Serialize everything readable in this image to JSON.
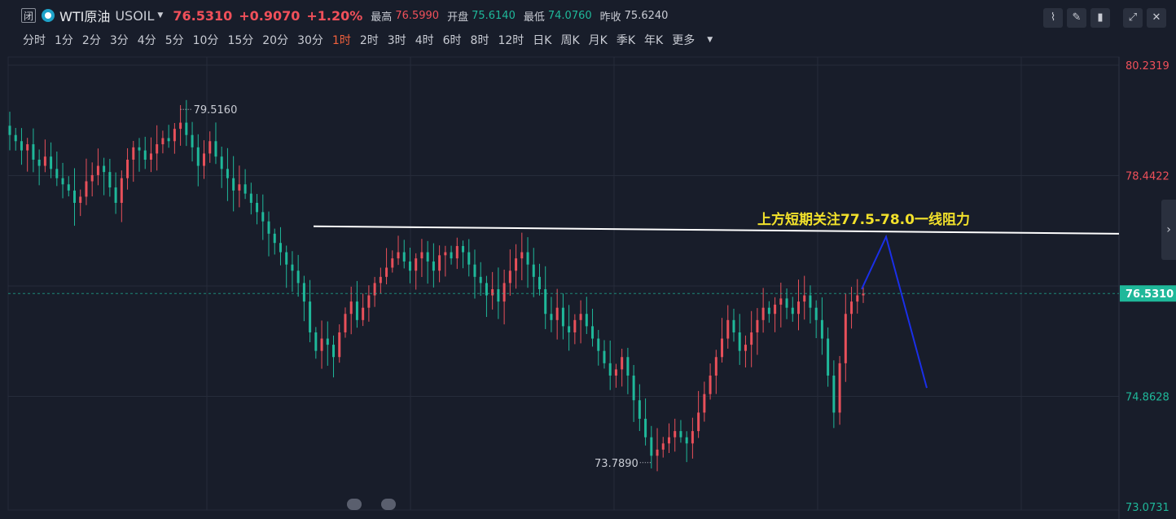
{
  "header": {
    "close_icon": "闭",
    "name": "WTI原油",
    "code": "USOIL",
    "last_price": "76.5310",
    "change": "+0.9070",
    "change_pct": "+1.20%",
    "stats": [
      {
        "label": "最高",
        "value": "76.5990",
        "tone": "red"
      },
      {
        "label": "开盘",
        "value": "75.6140",
        "tone": "green"
      },
      {
        "label": "最低",
        "value": "74.0760",
        "tone": "green"
      },
      {
        "label": "昨收",
        "value": "75.6240",
        "tone": "plain"
      }
    ],
    "timeframes": [
      "分时",
      "1分",
      "2分",
      "3分",
      "4分",
      "5分",
      "10分",
      "15分",
      "20分",
      "30分",
      "1时",
      "2时",
      "3时",
      "4时",
      "6时",
      "8时",
      "12时",
      "日K",
      "周K",
      "月K",
      "季K",
      "年K",
      "更多"
    ],
    "active_timeframe": "1时",
    "tool_icons": [
      "line-chart-icon",
      "pen-icon",
      "candle-icon",
      "expand-icon",
      "close-icon"
    ]
  },
  "chart_data": {
    "type": "candlestick",
    "ylim": [
      73.0731,
      80.2319
    ],
    "ytick_labels": [
      "80.2319",
      "78.4422",
      "74.8628",
      "73.0731"
    ],
    "current_price_label": "76.5310",
    "current_price": 76.531,
    "high_marker": "79.5160",
    "low_marker": "73.7890",
    "annotation": "上方短期关注77.5-78.0一线阻力",
    "resistance_line": {
      "from": 77.62,
      "to": 77.5
    },
    "projection_path": [
      76.6,
      77.45,
      75.0
    ],
    "colors": {
      "up": "#e8505a",
      "down": "#1fb89a",
      "line": "#ffffff",
      "projection": "#1a2fe8",
      "annotation": "#f2e12b"
    },
    "close_path": [
      79.1,
      79.0,
      78.85,
      78.95,
      78.7,
      78.6,
      78.75,
      78.55,
      78.4,
      78.3,
      78.2,
      78.0,
      78.1,
      78.35,
      78.45,
      78.6,
      78.5,
      78.25,
      78.0,
      78.4,
      78.7,
      78.9,
      78.85,
      78.7,
      78.8,
      78.95,
      79.05,
      79.0,
      79.2,
      79.3,
      79.1,
      78.9,
      78.6,
      78.8,
      79.0,
      78.75,
      78.55,
      78.4,
      78.2,
      78.3,
      78.15,
      78.0,
      77.85,
      77.7,
      77.5,
      77.35,
      77.2,
      77.0,
      76.9,
      76.7,
      76.4,
      75.9,
      75.6,
      75.8,
      75.7,
      75.5,
      75.9,
      76.2,
      76.4,
      76.1,
      76.3,
      76.5,
      76.7,
      76.8,
      76.95,
      77.1,
      77.2,
      77.05,
      76.9,
      77.1,
      77.2,
      77.05,
      76.9,
      77.15,
      77.2,
      77.1,
      77.3,
      77.2,
      77.0,
      76.8,
      76.7,
      76.5,
      76.6,
      76.4,
      76.7,
      76.9,
      77.1,
      77.2,
      77.0,
      76.8,
      76.6,
      76.2,
      76.1,
      76.3,
      76.0,
      75.9,
      76.1,
      76.2,
      76.0,
      75.8,
      75.6,
      75.4,
      75.2,
      75.3,
      75.5,
      75.2,
      74.8,
      74.5,
      74.2,
      73.9,
      74.0,
      74.1,
      74.2,
      74.3,
      74.2,
      74.1,
      74.3,
      74.6,
      74.9,
      75.2,
      75.5,
      75.8,
      76.1,
      75.9,
      75.6,
      75.7,
      75.9,
      76.1,
      76.3,
      76.2,
      76.35,
      76.45,
      76.3,
      76.2,
      76.4,
      76.5,
      76.3,
      76.1,
      75.8,
      75.2,
      74.6,
      75.4,
      76.2,
      76.4,
      76.5,
      76.53
    ]
  }
}
